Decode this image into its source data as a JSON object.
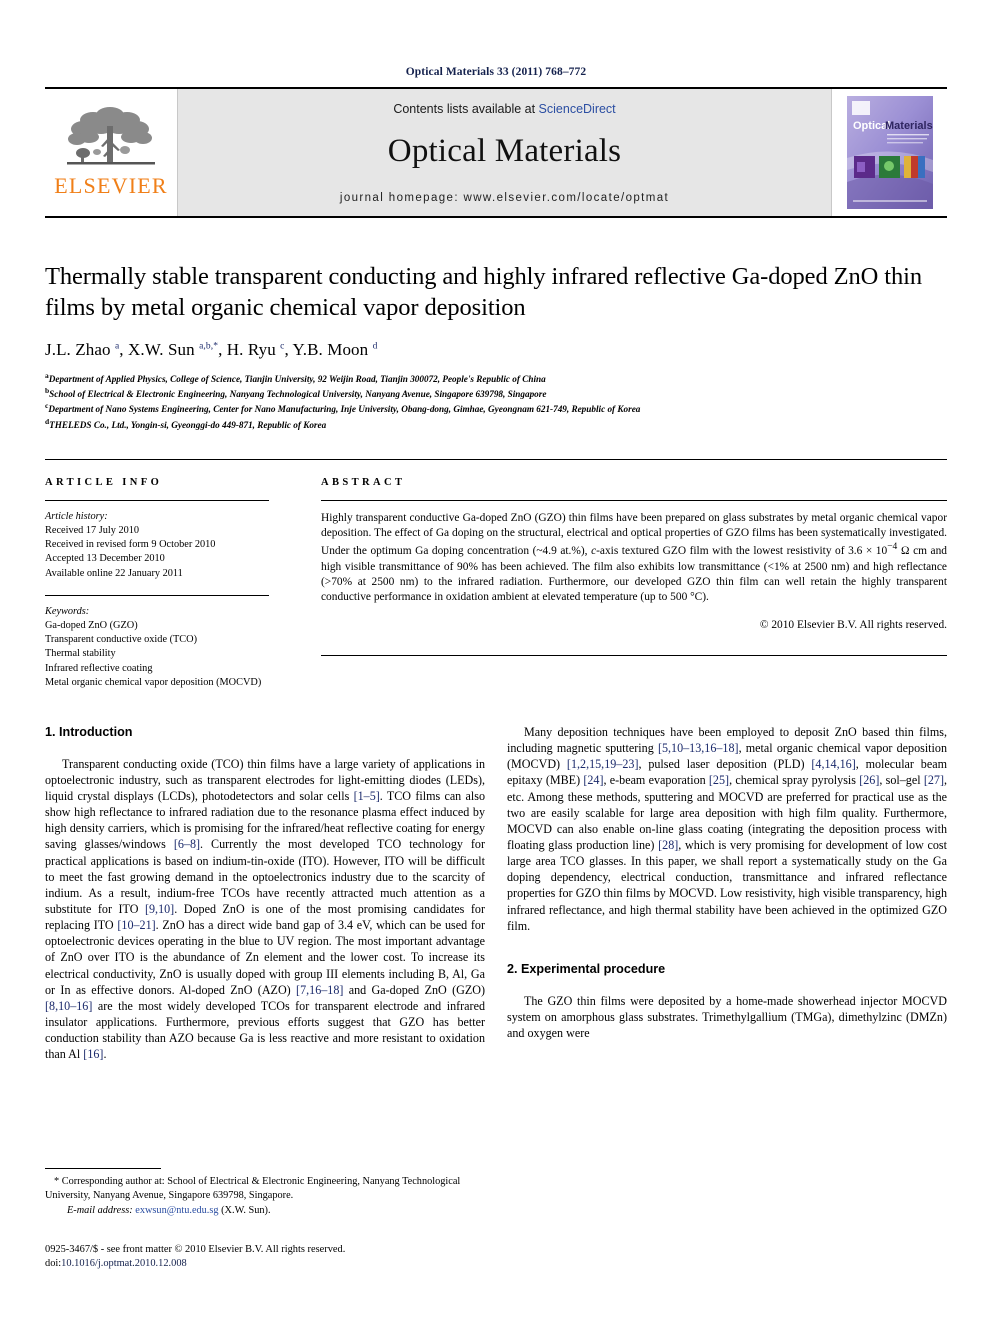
{
  "running_head": "Optical Materials 33 (2011) 768–772",
  "masthead": {
    "publisher_name": "ELSEVIER",
    "contents_prefix": "Contents lists available at ",
    "contents_link": "ScienceDirect",
    "journal_title": "Optical Materials",
    "homepage": "journal homepage: www.elsevier.com/locate/optmat",
    "cover_title_1": "Optical",
    "cover_title_2": "Materials"
  },
  "article": {
    "title": "Thermally stable transparent conducting and highly infrared reflective Ga-doped ZnO thin films by metal organic chemical vapor deposition",
    "authors_html": "J.L. Zhao <sup>a</sup>, X.W. Sun <sup>a,b,*</sup>, H. Ryu <sup>c</sup>, Y.B. Moon <sup>d</sup>",
    "affiliations": [
      {
        "mark": "a",
        "text": "Department of Applied Physics, College of Science, Tianjin University, 92 Weijin Road, Tianjin 300072, People's Republic of China"
      },
      {
        "mark": "b",
        "text": "School of Electrical & Electronic Engineering, Nanyang Technological University, Nanyang Avenue, Singapore 639798, Singapore"
      },
      {
        "mark": "c",
        "text": "Department of Nano Systems Engineering, Center for Nano Manufacturing, Inje University, Obang-dong, Gimhae, Gyeongnam 621-749, Republic of Korea"
      },
      {
        "mark": "d",
        "text": "THELEDS Co., Ltd., Yongin-si, Gyeonggi-do 449-871, Republic of Korea"
      }
    ]
  },
  "article_info": {
    "heading": "ARTICLE INFO",
    "history_label": "Article history:",
    "history": [
      "Received 17 July 2010",
      "Received in revised form 9 October 2010",
      "Accepted 13 December 2010",
      "Available online 22 January 2011"
    ],
    "keywords_label": "Keywords:",
    "keywords": [
      "Ga-doped ZnO (GZO)",
      "Transparent conductive oxide (TCO)",
      "Thermal stability",
      "Infrared reflective coating",
      "Metal organic chemical vapor deposition (MOCVD)"
    ]
  },
  "abstract": {
    "heading": "ABSTRACT",
    "text_html": "Highly transparent conductive Ga-doped ZnO (GZO) thin films have been prepared on glass substrates by metal organic chemical vapor deposition. The effect of Ga doping on the structural, electrical and optical properties of GZO films has been systematically investigated. Under the optimum Ga doping concentration (~4.9 at.%), <i>c</i>-axis textured GZO film with the lowest resistivity of 3.6 &#215; 10<sup>&#8722;4</sup> &#8486; cm and high visible transmittance of 90% has been achieved. The film also exhibits low transmittance (&lt;1% at 2500 nm) and high reflectance (&gt;70% at 2500 nm) to the infrared radiation. Furthermore, our developed GZO thin film can well retain the highly transparent conductive performance in oxidation ambient at elevated temperature (up to 500 &#176;C).",
    "copyright": "© 2010 Elsevier B.V. All rights reserved."
  },
  "sections": {
    "introduction_heading": "1. Introduction",
    "experimental_heading": "2. Experimental procedure"
  },
  "body": {
    "left_p1_html": "Transparent conducting oxide (TCO) thin films have a large variety of applications in optoelectronic industry, such as transparent electrodes for light-emitting diodes (LEDs), liquid crystal displays (LCDs), photodetectors and solar cells <span class=\"ref\">[1&#8211;5]</span>. TCO films can also show high reflectance to infrared radiation due to the resonance plasma effect induced by high density carriers, which is promising for the infrared/heat reflective coating for energy saving glasses/windows <span class=\"ref\">[6&#8211;8]</span>. Currently the most developed TCO technology for practical applications is based on indium-tin-oxide (ITO). However, ITO will be difficult to meet the fast growing demand in the optoelectronics industry due to the scarcity of indium. As a result, indium-free TCOs have recently attracted much attention as a substitute for ITO <span class=\"ref\">[9,10]</span>. Doped ZnO is one of the most promising candidates for replacing ITO <span class=\"ref\">[10&#8211;21]</span>. ZnO has a direct wide band gap of 3.4 eV, which can be used for optoelectronic devices operating in the blue to UV region. The most important advantage of ZnO over ITO is the abundance of Zn element and the lower cost. To increase its electrical conductivity, ZnO is usually doped with group III elements including B, Al, Ga or In as effective donors. Al-doped ZnO (AZO) <span class=\"ref\">[7,16&#8211;18]</span> and Ga-doped ZnO (GZO) <span class=\"ref\">[8,10&#8211;16]</span> are the most widely developed TCOs for transparent electrode and infrared insulator applications. Furthermore, previous efforts suggest that GZO has better conduction stability than AZO because Ga is less reactive and more resistant to oxidation than Al <span class=\"ref\">[16]</span>.",
    "right_p2_html": "Many deposition techniques have been employed to deposit ZnO based thin films, including magnetic sputtering <span class=\"ref\">[5,10&#8211;13,16&#8211;18]</span>, metal organic chemical vapor deposition (MOCVD) <span class=\"ref\">[1,2,15,19&#8211;23]</span>, pulsed laser deposition (PLD) <span class=\"ref\">[4,14,16]</span>, molecular beam epitaxy (MBE) <span class=\"ref\">[24]</span>, e-beam evaporation <span class=\"ref\">[25]</span>, chemical spray pyrolysis <span class=\"ref\">[26]</span>, sol&#8211;gel <span class=\"ref\">[27]</span>, etc. Among these methods, sputtering and MOCVD are preferred for practical use as the two are easily scalable for large area deposition with high film quality. Furthermore, MOCVD can also enable on-line glass coating (integrating the deposition process with floating glass production line) <span class=\"ref\">[28]</span>, which is very promising for development of low cost large area TCO glasses. In this paper, we shall report a systematically study on the Ga doping dependency, electrical conduction, transmittance and infrared reflectance properties for GZO thin films by MOCVD. Low resistivity, high visible transparency, high infrared reflectance, and high thermal stability have been achieved in the optimized GZO film.",
    "right_p3_html": "The GZO thin films were deposited by a home-made showerhead injector MOCVD system on amorphous glass substrates. Trimethylgallium (TMGa), dimethylzinc (DMZn) and oxygen were"
  },
  "footnote": {
    "corresponding_html": "* Corresponding author at: School of Electrical &amp; Electronic Engineering, Nanyang Technological University, Nanyang Avenue, Singapore 639798, Singapore.",
    "email_label": "E-mail address:",
    "email": "exwsun@ntu.edu.sg",
    "email_suffix": "(X.W. Sun)."
  },
  "imprint": {
    "line1": "0925-3467/$ - see front matter © 2010 Elsevier B.V. All rights reserved.",
    "doi_label": "doi:",
    "doi_value": "10.1016/j.optmat.2010.12.008"
  },
  "colors": {
    "link_blue": "#2b4ea2",
    "ref_navy": "#1b2a6b",
    "elsevier_orange": "#f07f18",
    "masthead_grey": "#e6e6e6"
  }
}
